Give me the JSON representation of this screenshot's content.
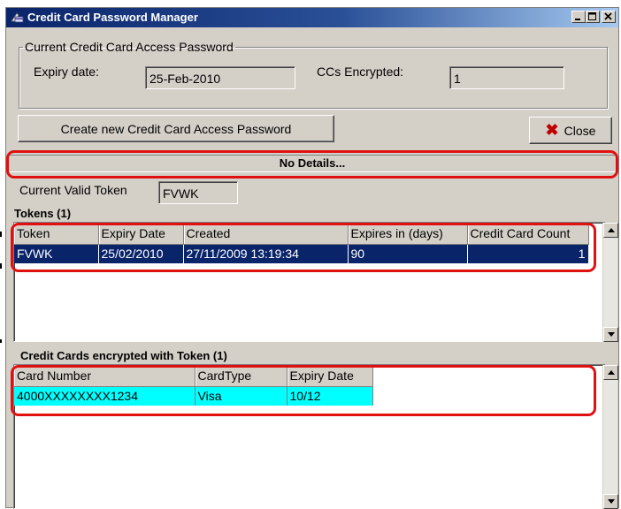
{
  "window": {
    "title": "Credit Card Password Manager",
    "controls": [
      "minimize",
      "maximize",
      "close"
    ]
  },
  "current_password": {
    "legend": "Current Credit Card Access Password",
    "expiry_label": "Expiry date:",
    "expiry_value": "25-Feb-2010",
    "encrypted_label": "CCs Encrypted:",
    "encrypted_value": "1"
  },
  "buttons": {
    "create_label": "Create new Credit Card Access Password",
    "close_label": "Close"
  },
  "details": {
    "text": "No Details..."
  },
  "current_token": {
    "label": "Current Valid Token",
    "value": "FVWK"
  },
  "tokens": {
    "heading": "Tokens (1)",
    "columns": [
      "Token",
      "Expiry Date",
      "Created",
      "Expires in (days)",
      "Credit Card Count"
    ],
    "rows": [
      [
        "FVWK",
        "25/02/2010",
        "27/11/2009 13:19:34",
        "90",
        "1"
      ]
    ]
  },
  "cards": {
    "heading": "Credit Cards encrypted with Token (1)",
    "columns": [
      "Card Number",
      "CardType",
      "Expiry Date"
    ],
    "rows": [
      [
        "4000XXXXXXXX1234",
        "Visa",
        "10/12"
      ]
    ]
  },
  "colors": {
    "selected_row": "#0a246a",
    "highlight_row": "#00ffff",
    "annotation": "#e01010",
    "close_icon": "#c00000"
  },
  "icons": {
    "app": "credit-card-icon",
    "close_button": "red-x-icon"
  }
}
